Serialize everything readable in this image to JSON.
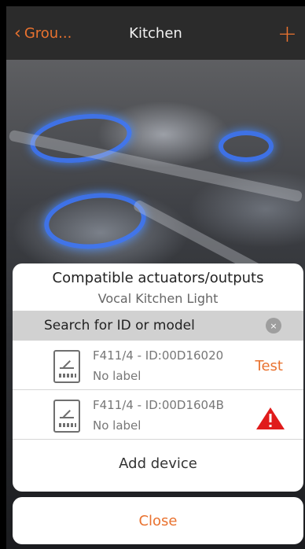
{
  "header": {
    "back_label": "Grou...",
    "title": "Kitchen",
    "add_label": "+"
  },
  "dialog": {
    "title": "Compatible actuators/outputs",
    "subtitle": "Vocal Kitchen Light",
    "search": {
      "placeholder": "Search for ID or model"
    },
    "devices": [
      {
        "id_text": "F411/4 - ID:00D16020",
        "label": "No label",
        "action": "Test"
      },
      {
        "id_text": "F411/4 - ID:00D1604B",
        "label": "No label",
        "action_icon": "warning-icon"
      }
    ],
    "add_device_label": "Add device"
  },
  "close_label": "Close",
  "colors": {
    "accent": "#e9722f",
    "warning": "#e01b1b"
  }
}
